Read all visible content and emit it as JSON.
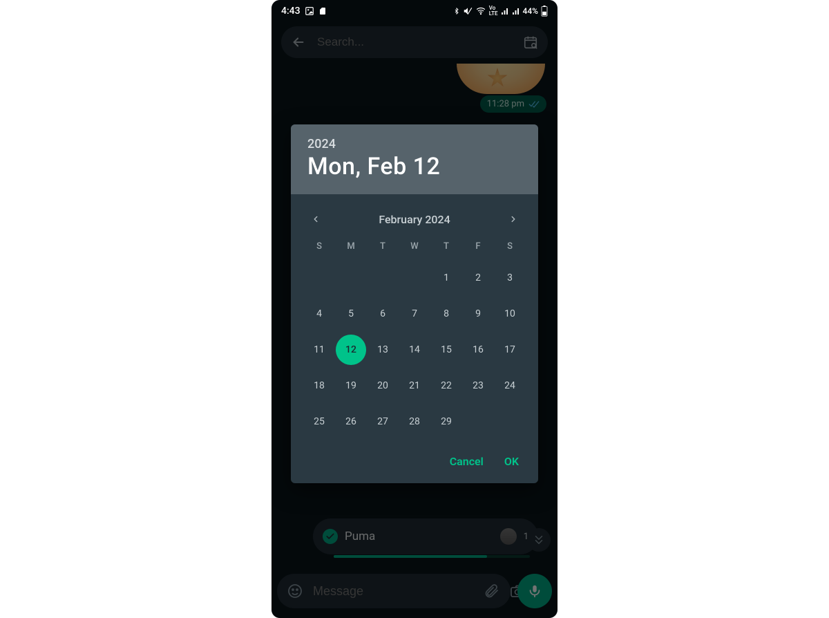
{
  "statusbar": {
    "time": "4:43",
    "battery_text": "44%"
  },
  "searchbar": {
    "placeholder": "Search..."
  },
  "chat": {
    "last_msg_time": "11:28 pm"
  },
  "draft": {
    "title": "Puma",
    "count": "1"
  },
  "inputbar": {
    "placeholder": "Message"
  },
  "datepicker": {
    "year": "2024",
    "date_string": "Mon, Feb 12",
    "month_label": "February 2024",
    "dow": [
      "S",
      "M",
      "T",
      "W",
      "T",
      "F",
      "S"
    ],
    "leading_blanks": 4,
    "days": 29,
    "selected": 12,
    "cancel": "Cancel",
    "ok": "OK"
  }
}
